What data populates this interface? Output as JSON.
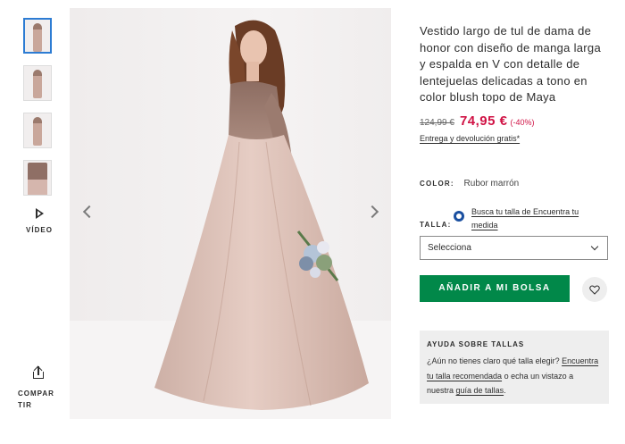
{
  "gallery": {
    "thumbnails": [
      "thumb-1",
      "thumb-2",
      "thumb-3",
      "thumb-4"
    ],
    "video_label": "VÍDEO",
    "share_label": "COMPARTIR"
  },
  "product": {
    "title": "Vestido largo de tul de dama de honor con diseño de manga larga y espalda en V con detalle de lentejuelas delicadas a tono en color blush topo de Maya",
    "old_price": "124,99 €",
    "new_price": "74,95 €",
    "discount": "(-40%)",
    "delivery_link": "Entrega y devolución gratis*",
    "color_label": "COLOR:",
    "color_value": "Rubor marrón",
    "size_label": "TALLA:",
    "fit_link": "Busca tu talla de Encuentra tu medida",
    "size_select_value": "Selecciona",
    "add_to_bag_label": "AÑADIR A MI BOLSA"
  },
  "size_help": {
    "title": "AYUDA SOBRE TALLAS",
    "text_1": "¿Aún no tienes claro qué talla elegir? ",
    "link_1": "Encuentra tu talla recomendada",
    "text_2": " o echa un vistazo a nuestra ",
    "link_2": "guía de tallas",
    "text_3": "."
  },
  "colors": {
    "price_sale": "#d01345",
    "cta_green": "#018849",
    "thumb_active_border": "#2d7cd3",
    "fit_icon": "#1a4fa0"
  },
  "icons": [
    "play-icon",
    "share-icon",
    "chevron-left-icon",
    "chevron-right-icon",
    "chevron-down-icon",
    "heart-icon",
    "fit-assistant-icon"
  ]
}
